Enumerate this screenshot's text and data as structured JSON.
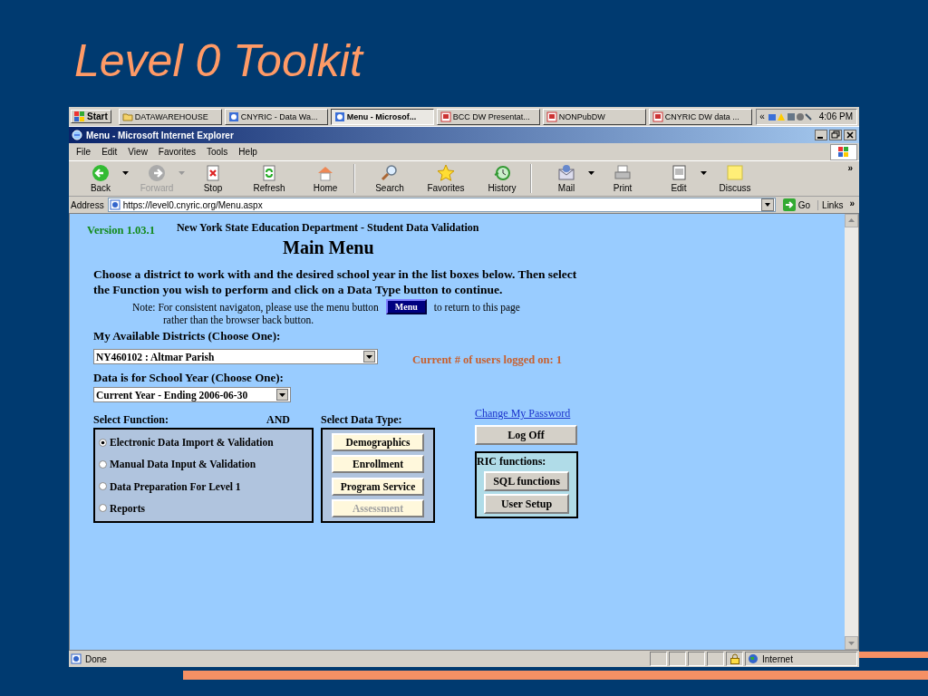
{
  "slide": {
    "title": "Level 0 Toolkit"
  },
  "taskbar": {
    "start": "Start",
    "tasks": [
      {
        "label": "DATAWAREHOUSE",
        "kind": "folder",
        "selected": false
      },
      {
        "label": "CNYRIC - Data Wa...",
        "kind": "browser",
        "selected": false
      },
      {
        "label": "Menu - Microsof...",
        "kind": "browser",
        "selected": true
      },
      {
        "label": "BCC DW Presentat...",
        "kind": "slides",
        "selected": false
      },
      {
        "label": "NONPubDW",
        "kind": "slides",
        "selected": false
      },
      {
        "label": "CNYRIC DW data ...",
        "kind": "slides",
        "selected": false
      }
    ],
    "tray_arrows": "«",
    "clock": "4:06 PM"
  },
  "window": {
    "title": "Menu - Microsoft Internet Explorer"
  },
  "menu_bar": [
    "File",
    "Edit",
    "View",
    "Favorites",
    "Tools",
    "Help"
  ],
  "toolbar": {
    "more": "»",
    "buttons": [
      {
        "label": "Back",
        "kind": "back",
        "disabled": false,
        "dropdown": true
      },
      {
        "label": "Forward",
        "kind": "forward",
        "disabled": true,
        "dropdown": true
      },
      {
        "label": "Stop",
        "kind": "stop",
        "disabled": false,
        "dropdown": false
      },
      {
        "label": "Refresh",
        "kind": "refresh",
        "disabled": false,
        "dropdown": false
      },
      {
        "label": "Home",
        "kind": "home",
        "disabled": false,
        "dropdown": false,
        "separator_after": true
      },
      {
        "label": "Search",
        "kind": "search",
        "disabled": false,
        "dropdown": false
      },
      {
        "label": "Favorites",
        "kind": "favorites",
        "disabled": false,
        "dropdown": false
      },
      {
        "label": "History",
        "kind": "history",
        "disabled": false,
        "dropdown": false,
        "separator_after": true
      },
      {
        "label": "Mail",
        "kind": "mail",
        "disabled": false,
        "dropdown": true
      },
      {
        "label": "Print",
        "kind": "print",
        "disabled": false,
        "dropdown": false
      },
      {
        "label": "Edit",
        "kind": "edit",
        "disabled": false,
        "dropdown": true
      },
      {
        "label": "Discuss",
        "kind": "discuss",
        "disabled": false,
        "dropdown": false
      }
    ]
  },
  "address_bar": {
    "label": "Address",
    "value": "https://level0.cnyric.org/Menu.aspx",
    "go": "Go",
    "links": "Links",
    "more": "»"
  },
  "page": {
    "version": "Version 1.03.1",
    "header": "New York State Education Department - Student Data Validation",
    "heading": "Main Menu",
    "instructions": "Choose a district to work with and the desired school year in the list boxes below.  Then select the Function you wish to perform and click on a Data Type button to continue.",
    "note_before": "Note: For consistent navigaton, please use the menu button",
    "menu_button": "Menu",
    "note_after": "to return to this page",
    "note_line2": "rather than the browser back button.",
    "districts_label": "My Available Districts (Choose One):",
    "district_value": "NY460102 : Altmar Parish",
    "users_logged_on": "Current # of users logged on: 1",
    "year_label": "Data is for School Year (Choose One):",
    "year_value": "Current Year - Ending 2006-06-30",
    "function_label": "Select Function:",
    "and_label": "AND",
    "functions": [
      {
        "label": "Electronic Data Import & Validation",
        "selected": true
      },
      {
        "label": "Manual Data Input & Validation",
        "selected": false
      },
      {
        "label": "Data Preparation For Level 1",
        "selected": false
      },
      {
        "label": "Reports",
        "selected": false
      }
    ],
    "data_type_label": "Select Data Type:",
    "data_types": [
      {
        "label": "Demographics",
        "disabled": false
      },
      {
        "label": "Enrollment",
        "disabled": false
      },
      {
        "label": "Program Service",
        "disabled": false
      },
      {
        "label": "Assessment",
        "disabled": true
      }
    ],
    "change_password": "Change My Password",
    "log_off": "Log Off",
    "ric_label": "RIC functions:",
    "ric_buttons": [
      "SQL functions",
      "User Setup"
    ]
  },
  "status_bar": {
    "text": "Done",
    "zone": "Internet"
  }
}
